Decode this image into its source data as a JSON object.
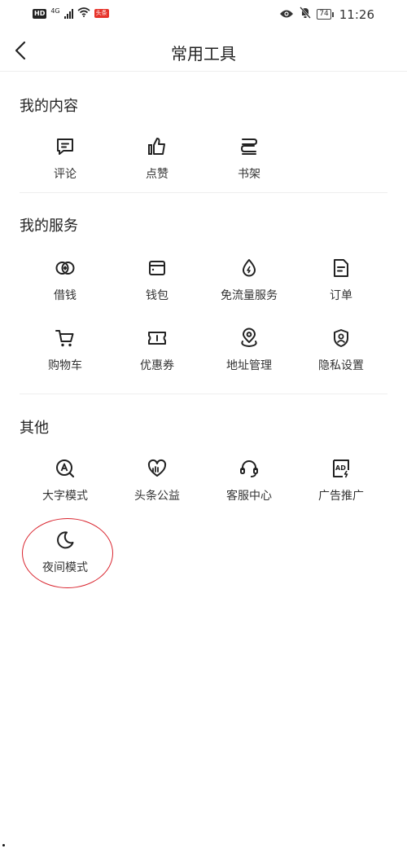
{
  "status_bar": {
    "hd": "HD",
    "network": "4G",
    "badge": "头条",
    "battery": "74",
    "time": "11:26"
  },
  "header": {
    "title": "常用工具"
  },
  "sections": {
    "my_content": {
      "title": "我的内容",
      "items": [
        "评论",
        "点赞",
        "书架"
      ]
    },
    "my_services": {
      "title": "我的服务",
      "items": [
        "借钱",
        "钱包",
        "免流量服务",
        "订单",
        "购物车",
        "优惠券",
        "地址管理",
        "隐私设置"
      ]
    },
    "other": {
      "title": "其他",
      "items": [
        "大字模式",
        "头条公益",
        "客服中心",
        "广告推广",
        "夜间模式"
      ]
    }
  },
  "icons": {
    "comment": "comment-icon",
    "like": "thumbs-up-icon",
    "bookshelf": "bookshelf-icon",
    "loan": "loan-icon",
    "wallet": "wallet-icon",
    "free_data": "water-drop-icon",
    "order": "order-document-icon",
    "cart": "shopping-cart-icon",
    "coupon": "coupon-ticket-icon",
    "address": "location-pin-icon",
    "privacy": "privacy-shield-icon",
    "large_text": "large-text-icon",
    "charity": "charity-heart-icon",
    "support": "headset-icon",
    "ad": "ad-icon",
    "night": "moon-icon"
  },
  "colors": {
    "annotation": "#d9232d",
    "text": "#222222",
    "divider": "#eeeeee"
  }
}
